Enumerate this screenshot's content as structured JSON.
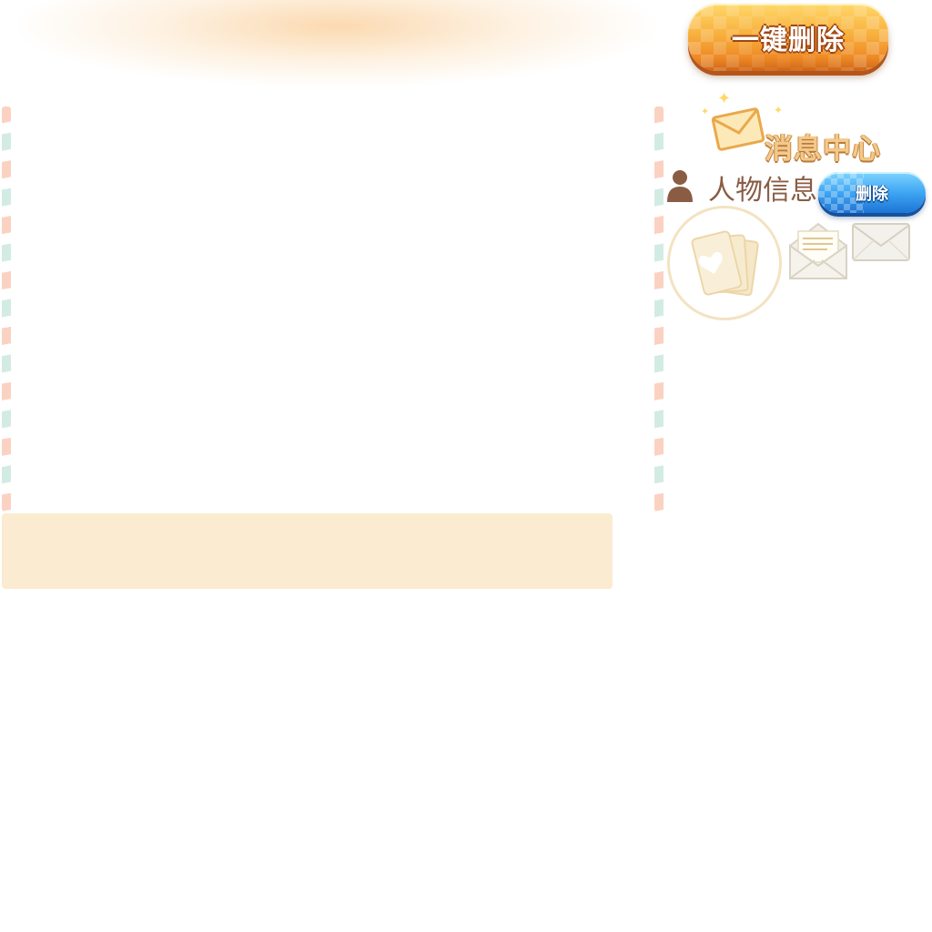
{
  "header": {
    "delete_all_label": "一键删除"
  },
  "sidebar": {
    "title": "消息中心",
    "person_label": "人物信息",
    "delete_label": "删除"
  },
  "icons": {
    "title_icon": "envelope-icon",
    "person_icon": "person-icon",
    "avatar_icon": "playing-cards-icon",
    "open_mail_icon": "open-envelope-icon",
    "closed_mail_icon": "closed-envelope-icon"
  },
  "colors": {
    "orange_button": "#f8b13e",
    "blue_button": "#3ea6f2",
    "panel_beige": "#faebd1",
    "stripe_pink": "#fbd2c2",
    "stripe_green": "#d3ece3",
    "title_gold": "#f3c98b",
    "person_text": "#8a5c44"
  }
}
